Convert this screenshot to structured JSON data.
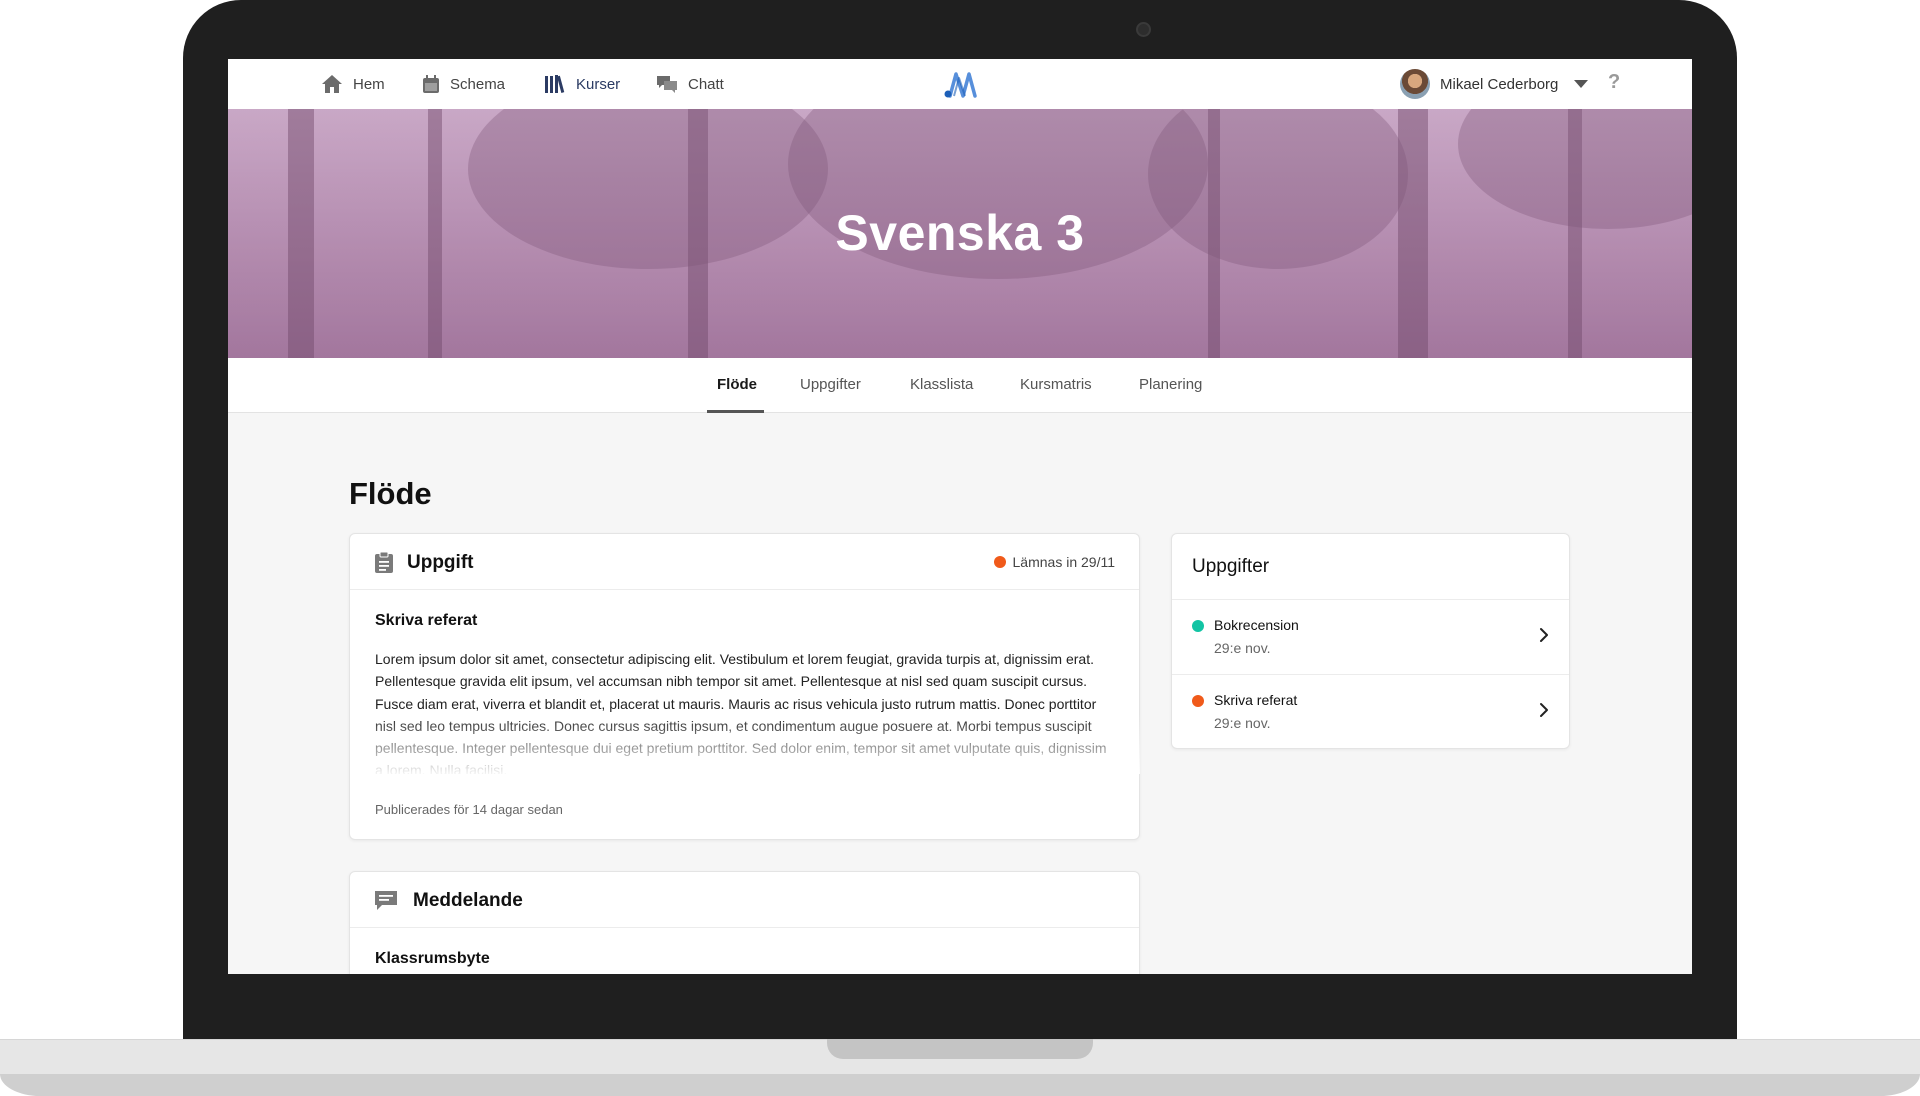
{
  "nav": {
    "items": [
      {
        "label": "Hem",
        "icon": "home-icon"
      },
      {
        "label": "Schema",
        "icon": "calendar-icon"
      },
      {
        "label": "Kurser",
        "icon": "books-icon"
      },
      {
        "label": "Chatt",
        "icon": "chat-icon"
      }
    ],
    "active": "Kurser",
    "logo": "app-logo",
    "user_name": "Mikael Cederborg",
    "help_label": "?"
  },
  "course": {
    "title": "Svenska 3"
  },
  "tabs": {
    "items": [
      "Flöde",
      "Uppgifter",
      "Klasslista",
      "Kursmatris",
      "Planering"
    ],
    "active": "Flöde"
  },
  "feed": {
    "title": "Flöde",
    "posts": [
      {
        "type_label": "Uppgift",
        "icon": "clipboard-icon",
        "due_label": "Lämnas in 29/11",
        "due_color": "#f05a1a",
        "title": "Skriva referat",
        "body": "Lorem ipsum dolor sit amet, consectetur adipiscing elit. Vestibulum et lorem feugiat, gravida turpis at, dignissim erat. Pellentesque gravida elit ipsum, vel accumsan nibh tempor sit amet. Pellentesque at nisl sed quam suscipit cursus. Fusce diam erat, viverra et blandit et, placerat ut mauris. Mauris ac risus vehicula justo rutrum mattis. Donec porttitor nisl sed leo tempus ultricies. Donec cursus sagittis ipsum, et condimentum augue posuere at. Morbi tempus suscipit pellentesque. Integer pellentesque dui eget pretium porttitor. Sed dolor enim, tempor sit amet vulputate quis, dignissim a lorem. Nulla facilisi.",
        "meta": "Publicerades för 14 dagar sedan"
      },
      {
        "type_label": "Meddelande",
        "icon": "message-icon",
        "title": "Klassrumsbyte"
      }
    ]
  },
  "sidebar": {
    "title": "Uppgifter",
    "items": [
      {
        "name": "Bokrecension",
        "date": "29:e nov.",
        "color": "#12c4a4"
      },
      {
        "name": "Skriva referat",
        "date": "29:e nov.",
        "color": "#f05a1a"
      }
    ]
  }
}
